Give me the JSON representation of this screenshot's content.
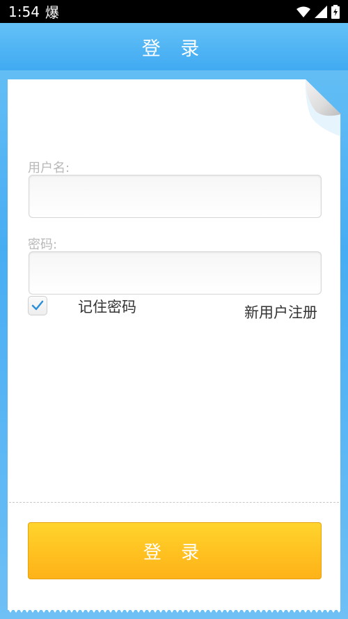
{
  "status_bar": {
    "time": "1:54",
    "app_icon_char": "爆",
    "icons": [
      "wifi-icon",
      "signal-icon",
      "battery-icon"
    ]
  },
  "header": {
    "title": "登 录"
  },
  "form": {
    "username_label": "用户名:",
    "username_value": "",
    "password_label": "密码:",
    "password_value": "",
    "remember_checked": true,
    "remember_label": "记住密码",
    "register_link": "新用户注册",
    "login_button": "登 录"
  },
  "colors": {
    "accent_blue": "#47adf3",
    "login_button": "#ffbf1f",
    "check_blue": "#2e8fd8"
  }
}
